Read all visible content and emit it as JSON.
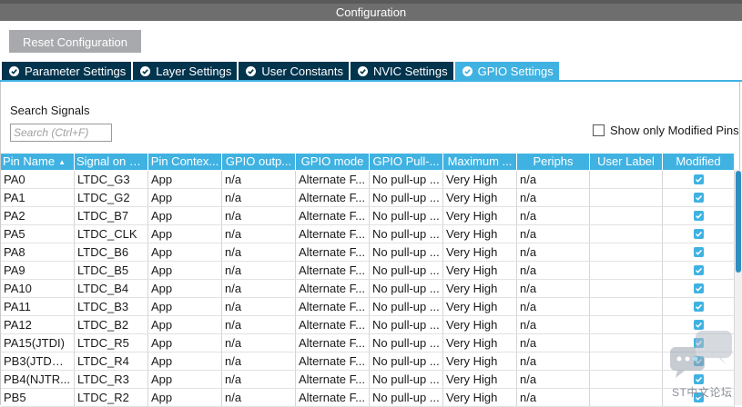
{
  "window": {
    "title": "Configuration"
  },
  "toolbar": {
    "reset_label": "Reset Configuration"
  },
  "tabs": [
    {
      "label": "Parameter Settings",
      "active": false
    },
    {
      "label": "Layer Settings",
      "active": false
    },
    {
      "label": "User Constants",
      "active": false
    },
    {
      "label": "NVIC Settings",
      "active": false
    },
    {
      "label": "GPIO Settings",
      "active": true
    }
  ],
  "search": {
    "label": "Search Signals",
    "placeholder": "Search (Ctrl+F)",
    "value": ""
  },
  "filter": {
    "show_modified_label": "Show only Modified Pins",
    "checked": false
  },
  "table": {
    "columns": [
      "Pin Name",
      "Signal on Pin",
      "Pin Contex...",
      "GPIO outp...",
      "GPIO mode",
      "GPIO Pull-...",
      "Maximum ...",
      "Periphs",
      "User Label",
      "Modified"
    ],
    "sorted_column": "Pin Name",
    "rows": [
      [
        "PA0",
        "LTDC_G3",
        "App",
        "n/a",
        "Alternate F...",
        "No pull-up ...",
        "Very High",
        "n/a",
        "",
        true
      ],
      [
        "PA1",
        "LTDC_G2",
        "App",
        "n/a",
        "Alternate F...",
        "No pull-up ...",
        "Very High",
        "n/a",
        "",
        true
      ],
      [
        "PA2",
        "LTDC_B7",
        "App",
        "n/a",
        "Alternate F...",
        "No pull-up ...",
        "Very High",
        "n/a",
        "",
        true
      ],
      [
        "PA5",
        "LTDC_CLK",
        "App",
        "n/a",
        "Alternate F...",
        "No pull-up ...",
        "Very High",
        "n/a",
        "",
        true
      ],
      [
        "PA8",
        "LTDC_B6",
        "App",
        "n/a",
        "Alternate F...",
        "No pull-up ...",
        "Very High",
        "n/a",
        "",
        true
      ],
      [
        "PA9",
        "LTDC_B5",
        "App",
        "n/a",
        "Alternate F...",
        "No pull-up ...",
        "Very High",
        "n/a",
        "",
        true
      ],
      [
        "PA10",
        "LTDC_B4",
        "App",
        "n/a",
        "Alternate F...",
        "No pull-up ...",
        "Very High",
        "n/a",
        "",
        true
      ],
      [
        "PA11",
        "LTDC_B3",
        "App",
        "n/a",
        "Alternate F...",
        "No pull-up ...",
        "Very High",
        "n/a",
        "",
        true
      ],
      [
        "PA12",
        "LTDC_B2",
        "App",
        "n/a",
        "Alternate F...",
        "No pull-up ...",
        "Very High",
        "n/a",
        "",
        true
      ],
      [
        "PA15(JTDI)",
        "LTDC_R5",
        "App",
        "n/a",
        "Alternate F...",
        "No pull-up ...",
        "Very High",
        "n/a",
        "",
        true
      ],
      [
        "PB3(JTDO/...",
        "LTDC_R4",
        "App",
        "n/a",
        "Alternate F...",
        "No pull-up ...",
        "Very High",
        "n/a",
        "",
        true
      ],
      [
        "PB4(NJTR...",
        "LTDC_R3",
        "App",
        "n/a",
        "Alternate F...",
        "No pull-up ...",
        "Very High",
        "n/a",
        "",
        true
      ],
      [
        "PB5",
        "LTDC_R2",
        "App",
        "n/a",
        "Alternate F...",
        "No pull-up ...",
        "Very High",
        "n/a",
        "",
        true
      ]
    ]
  },
  "watermark": {
    "text": "ST中文论坛"
  },
  "colors": {
    "accent": "#3fb2e2",
    "tab_dark": "#02344e",
    "title_bar": "#6e6e6e",
    "button": "#a7a9ac"
  }
}
